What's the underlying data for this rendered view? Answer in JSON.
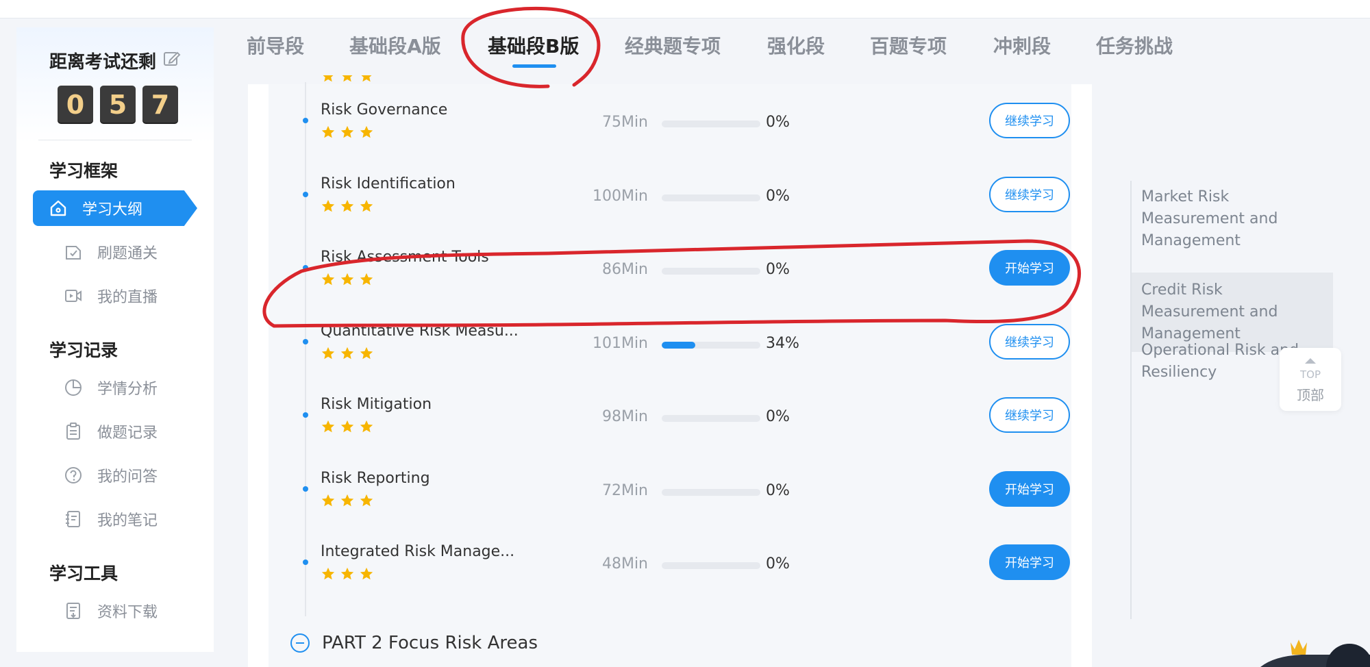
{
  "sidebar": {
    "countdown_label": "距离考试还剩",
    "digits": [
      "0",
      "5",
      "7"
    ],
    "sections": [
      {
        "title": "学习框架",
        "items": [
          {
            "label": "学习大纲",
            "icon": "home-icon",
            "active": true
          },
          {
            "label": "刷题通关",
            "icon": "exam-icon",
            "active": false
          },
          {
            "label": "我的直播",
            "icon": "video-icon",
            "active": false
          }
        ]
      },
      {
        "title": "学习记录",
        "items": [
          {
            "label": "学情分析",
            "icon": "pie-chart-icon",
            "active": false
          },
          {
            "label": "做题记录",
            "icon": "clipboard-icon",
            "active": false
          },
          {
            "label": "我的问答",
            "icon": "question-icon",
            "active": false
          },
          {
            "label": "我的笔记",
            "icon": "notebook-icon",
            "active": false
          }
        ]
      },
      {
        "title": "学习工具",
        "items": [
          {
            "label": "资料下载",
            "icon": "download-doc-icon",
            "active": false
          }
        ]
      }
    ]
  },
  "tabs": [
    {
      "label": "前导段",
      "active": false
    },
    {
      "label": "基础段A版",
      "active": false
    },
    {
      "label": "基础段B版",
      "active": true
    },
    {
      "label": "经典题专项",
      "active": false
    },
    {
      "label": "强化段",
      "active": false
    },
    {
      "label": "百题专项",
      "active": false
    },
    {
      "label": "冲刺段",
      "active": false
    },
    {
      "label": "任务挑战",
      "active": false
    }
  ],
  "lessons": [
    {
      "title": "Risk Governance",
      "stars": 3,
      "duration": "75Min",
      "progress": 0,
      "percent": "0%",
      "button": "继续学习",
      "button_style": "outline"
    },
    {
      "title": "Risk Identification",
      "stars": 3,
      "duration": "100Min",
      "progress": 0,
      "percent": "0%",
      "button": "继续学习",
      "button_style": "outline"
    },
    {
      "title": "Risk Assessment Tools",
      "stars": 3,
      "duration": "86Min",
      "progress": 0,
      "percent": "0%",
      "button": "开始学习",
      "button_style": "solid"
    },
    {
      "title": "Quantitative Risk Measu...",
      "stars": 3,
      "duration": "101Min",
      "progress": 0.34,
      "percent": "34%",
      "button": "继续学习",
      "button_style": "outline"
    },
    {
      "title": "Risk Mitigation",
      "stars": 3,
      "duration": "98Min",
      "progress": 0,
      "percent": "0%",
      "button": "继续学习",
      "button_style": "outline"
    },
    {
      "title": "Risk Reporting",
      "stars": 3,
      "duration": "72Min",
      "progress": 0,
      "percent": "0%",
      "button": "开始学习",
      "button_style": "solid"
    },
    {
      "title": "Integrated Risk Manage...",
      "stars": 3,
      "duration": "48Min",
      "progress": 0,
      "percent": "0%",
      "button": "开始学习",
      "button_style": "solid"
    }
  ],
  "part2_label": "PART 2 Focus Risk Areas",
  "outline": [
    {
      "label": "Market Risk Measurement and Management",
      "active": false
    },
    {
      "label": "Credit Risk Measurement and Management",
      "active": true
    },
    {
      "label": "Operational Risk and Resiliency",
      "active": false
    }
  ],
  "top_button": {
    "icon_text": "TOP",
    "label": "顶部"
  },
  "colors": {
    "accent": "#1f8ff0",
    "star": "#f7b500",
    "annotation": "#d9262c"
  }
}
